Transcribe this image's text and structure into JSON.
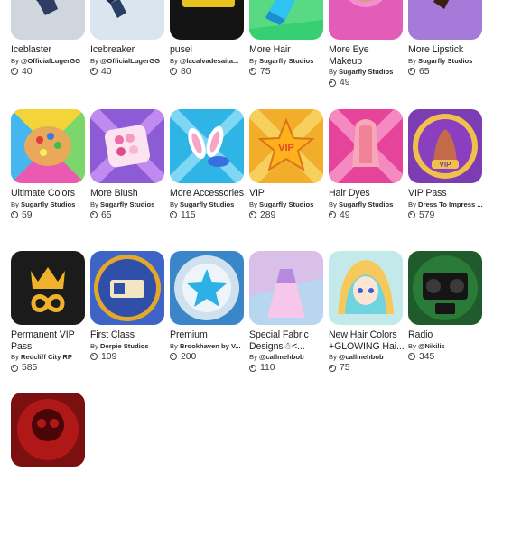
{
  "rows": [
    [
      {
        "name": "Iceblaster",
        "by": "By",
        "creator": "@OfficialLugerGG",
        "price": "40",
        "icon": "ice-blaster-icon",
        "bg": "#cfd6df"
      },
      {
        "name": "Icebreaker",
        "by": "By",
        "creator": "@OfficialLugerGG",
        "price": "40",
        "icon": "ice-breaker-icon",
        "bg": "#d6e6f2"
      },
      {
        "name": "pusei",
        "by": "By",
        "creator": "@lacalvadesaita...",
        "price": "80",
        "icon": "gold-bar-icon",
        "bg": "#151515"
      },
      {
        "name": "More Hair",
        "by": "By",
        "creator": "Sugarfly Studios",
        "price": "75",
        "icon": "hair-icon",
        "bg": "#3ad47a"
      },
      {
        "name": "More Eye Makeup",
        "by": "By",
        "creator": "Sugarfly Studios",
        "price": "49",
        "icon": "eye-makeup-icon",
        "bg": "#e05ab7"
      },
      {
        "name": "More Lipstick",
        "by": "By",
        "creator": "Sugarfly Studios",
        "price": "65",
        "icon": "lipstick-icon",
        "bg": "#a77bd9"
      }
    ],
    [
      {
        "name": "Ultimate Colors",
        "by": "By",
        "creator": "Sugarfly Studios",
        "price": "59",
        "icon": "palette-icon",
        "bg": "#6bd16b"
      },
      {
        "name": "More Blush",
        "by": "By",
        "creator": "Sugarfly Studios",
        "price": "65",
        "icon": "blush-palette-icon",
        "bg": "#8a5ad6"
      },
      {
        "name": "More Accessories",
        "by": "By",
        "creator": "Sugarfly Studios",
        "price": "115",
        "icon": "bunny-ears-icon",
        "bg": "#2fb6e8"
      },
      {
        "name": "VIP",
        "by": "By",
        "creator": "Sugarfly Studios",
        "price": "289",
        "icon": "vip-star-icon",
        "bg": "#f0a824"
      },
      {
        "name": "Hair Dyes",
        "by": "By",
        "creator": "Sugarfly Studios",
        "price": "49",
        "icon": "hair-dye-icon",
        "bg": "#e6449c"
      },
      {
        "name": "VIP Pass",
        "by": "By",
        "creator": "Dress To Impress ...",
        "price": "579",
        "icon": "vip-pass-icon",
        "bg": "#7a3bb0"
      }
    ],
    [
      {
        "name": "Permanent VIP Pass",
        "by": "By",
        "creator": "Redcliff City RP",
        "price": "585",
        "icon": "crown-infinity-icon",
        "bg": "#1c1c1c"
      },
      {
        "name": "First Class",
        "by": "By",
        "creator": "Derpie Studios",
        "price": "109",
        "icon": "first-class-ticket-icon",
        "bg": "#3d62c7"
      },
      {
        "name": "Premium",
        "by": "By",
        "creator": "Brookhaven by V...",
        "price": "200",
        "icon": "premium-star-icon",
        "bg": "#1f6fa8"
      },
      {
        "name": "Special Fabric Designs☃<...",
        "by": "By",
        "creator": "@callmehbob",
        "price": "110",
        "icon": "fabric-dress-icon",
        "bg": "#b9d8f2"
      },
      {
        "name": "New Hair Colors +GLOWING Hai...",
        "by": "By",
        "creator": "@callmehbob",
        "price": "75",
        "icon": "anime-girl-icon",
        "bg": "#bfe8e9"
      },
      {
        "name": "Radio",
        "by": "By",
        "creator": "@Nikilis",
        "price": "345",
        "icon": "radio-icon",
        "bg": "#1e5a2a"
      }
    ],
    [
      {
        "name": "",
        "by": "",
        "creator": "",
        "price": "",
        "icon": "skull-icon",
        "bg": "#7a0f0f"
      }
    ]
  ]
}
